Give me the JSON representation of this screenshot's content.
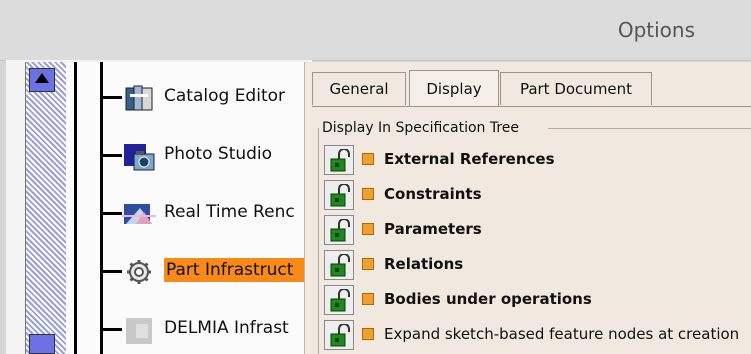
{
  "window": {
    "title": "Options"
  },
  "tree": {
    "items": [
      {
        "label": "Catalog Editor",
        "icon": "catalog-editor-icon",
        "selected": false
      },
      {
        "label": "Photo Studio",
        "icon": "photo-studio-icon",
        "selected": false
      },
      {
        "label": "Real Time Renc",
        "icon": "real-time-rendering-icon",
        "selected": false
      },
      {
        "label": "Part Infrastruct",
        "icon": "gear-icon",
        "selected": true
      },
      {
        "label": "DELMIA Infrast",
        "icon": "delmia-infrastructure-icon",
        "selected": false
      }
    ]
  },
  "tabs": [
    {
      "label": "General",
      "active": false
    },
    {
      "label": "Display",
      "active": true
    },
    {
      "label": "Part Document",
      "active": false
    }
  ],
  "display": {
    "section_title": "Display In Specification Tree",
    "options": [
      {
        "label": "External References",
        "bold": true
      },
      {
        "label": "Constraints",
        "bold": true
      },
      {
        "label": "Parameters",
        "bold": true
      },
      {
        "label": "Relations",
        "bold": true
      },
      {
        "label": "Bodies under operations",
        "bold": true
      },
      {
        "label": "Expand sketch-based feature nodes at creation",
        "bold": false
      }
    ]
  },
  "colors": {
    "selection": "#f98a18",
    "scrollbar_thumb": "#6c71e6",
    "panel_bg": "#f1e8df"
  }
}
